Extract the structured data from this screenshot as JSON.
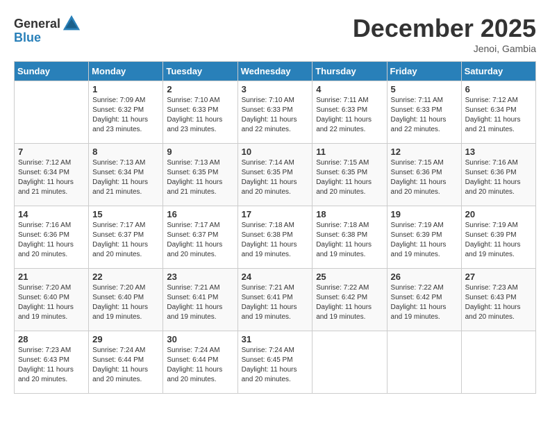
{
  "header": {
    "logo_general": "General",
    "logo_blue": "Blue",
    "month_year": "December 2025",
    "location": "Jenoi, Gambia"
  },
  "days_of_week": [
    "Sunday",
    "Monday",
    "Tuesday",
    "Wednesday",
    "Thursday",
    "Friday",
    "Saturday"
  ],
  "weeks": [
    [
      {
        "day": "",
        "info": ""
      },
      {
        "day": "1",
        "info": "Sunrise: 7:09 AM\nSunset: 6:32 PM\nDaylight: 11 hours\nand 23 minutes."
      },
      {
        "day": "2",
        "info": "Sunrise: 7:10 AM\nSunset: 6:33 PM\nDaylight: 11 hours\nand 23 minutes."
      },
      {
        "day": "3",
        "info": "Sunrise: 7:10 AM\nSunset: 6:33 PM\nDaylight: 11 hours\nand 22 minutes."
      },
      {
        "day": "4",
        "info": "Sunrise: 7:11 AM\nSunset: 6:33 PM\nDaylight: 11 hours\nand 22 minutes."
      },
      {
        "day": "5",
        "info": "Sunrise: 7:11 AM\nSunset: 6:33 PM\nDaylight: 11 hours\nand 22 minutes."
      },
      {
        "day": "6",
        "info": "Sunrise: 7:12 AM\nSunset: 6:34 PM\nDaylight: 11 hours\nand 21 minutes."
      }
    ],
    [
      {
        "day": "7",
        "info": "Sunrise: 7:12 AM\nSunset: 6:34 PM\nDaylight: 11 hours\nand 21 minutes."
      },
      {
        "day": "8",
        "info": "Sunrise: 7:13 AM\nSunset: 6:34 PM\nDaylight: 11 hours\nand 21 minutes."
      },
      {
        "day": "9",
        "info": "Sunrise: 7:13 AM\nSunset: 6:35 PM\nDaylight: 11 hours\nand 21 minutes."
      },
      {
        "day": "10",
        "info": "Sunrise: 7:14 AM\nSunset: 6:35 PM\nDaylight: 11 hours\nand 20 minutes."
      },
      {
        "day": "11",
        "info": "Sunrise: 7:15 AM\nSunset: 6:35 PM\nDaylight: 11 hours\nand 20 minutes."
      },
      {
        "day": "12",
        "info": "Sunrise: 7:15 AM\nSunset: 6:36 PM\nDaylight: 11 hours\nand 20 minutes."
      },
      {
        "day": "13",
        "info": "Sunrise: 7:16 AM\nSunset: 6:36 PM\nDaylight: 11 hours\nand 20 minutes."
      }
    ],
    [
      {
        "day": "14",
        "info": "Sunrise: 7:16 AM\nSunset: 6:36 PM\nDaylight: 11 hours\nand 20 minutes."
      },
      {
        "day": "15",
        "info": "Sunrise: 7:17 AM\nSunset: 6:37 PM\nDaylight: 11 hours\nand 20 minutes."
      },
      {
        "day": "16",
        "info": "Sunrise: 7:17 AM\nSunset: 6:37 PM\nDaylight: 11 hours\nand 20 minutes."
      },
      {
        "day": "17",
        "info": "Sunrise: 7:18 AM\nSunset: 6:38 PM\nDaylight: 11 hours\nand 19 minutes."
      },
      {
        "day": "18",
        "info": "Sunrise: 7:18 AM\nSunset: 6:38 PM\nDaylight: 11 hours\nand 19 minutes."
      },
      {
        "day": "19",
        "info": "Sunrise: 7:19 AM\nSunset: 6:39 PM\nDaylight: 11 hours\nand 19 minutes."
      },
      {
        "day": "20",
        "info": "Sunrise: 7:19 AM\nSunset: 6:39 PM\nDaylight: 11 hours\nand 19 minutes."
      }
    ],
    [
      {
        "day": "21",
        "info": "Sunrise: 7:20 AM\nSunset: 6:40 PM\nDaylight: 11 hours\nand 19 minutes."
      },
      {
        "day": "22",
        "info": "Sunrise: 7:20 AM\nSunset: 6:40 PM\nDaylight: 11 hours\nand 19 minutes."
      },
      {
        "day": "23",
        "info": "Sunrise: 7:21 AM\nSunset: 6:41 PM\nDaylight: 11 hours\nand 19 minutes."
      },
      {
        "day": "24",
        "info": "Sunrise: 7:21 AM\nSunset: 6:41 PM\nDaylight: 11 hours\nand 19 minutes."
      },
      {
        "day": "25",
        "info": "Sunrise: 7:22 AM\nSunset: 6:42 PM\nDaylight: 11 hours\nand 19 minutes."
      },
      {
        "day": "26",
        "info": "Sunrise: 7:22 AM\nSunset: 6:42 PM\nDaylight: 11 hours\nand 19 minutes."
      },
      {
        "day": "27",
        "info": "Sunrise: 7:23 AM\nSunset: 6:43 PM\nDaylight: 11 hours\nand 20 minutes."
      }
    ],
    [
      {
        "day": "28",
        "info": "Sunrise: 7:23 AM\nSunset: 6:43 PM\nDaylight: 11 hours\nand 20 minutes."
      },
      {
        "day": "29",
        "info": "Sunrise: 7:24 AM\nSunset: 6:44 PM\nDaylight: 11 hours\nand 20 minutes."
      },
      {
        "day": "30",
        "info": "Sunrise: 7:24 AM\nSunset: 6:44 PM\nDaylight: 11 hours\nand 20 minutes."
      },
      {
        "day": "31",
        "info": "Sunrise: 7:24 AM\nSunset: 6:45 PM\nDaylight: 11 hours\nand 20 minutes."
      },
      {
        "day": "",
        "info": ""
      },
      {
        "day": "",
        "info": ""
      },
      {
        "day": "",
        "info": ""
      }
    ]
  ]
}
